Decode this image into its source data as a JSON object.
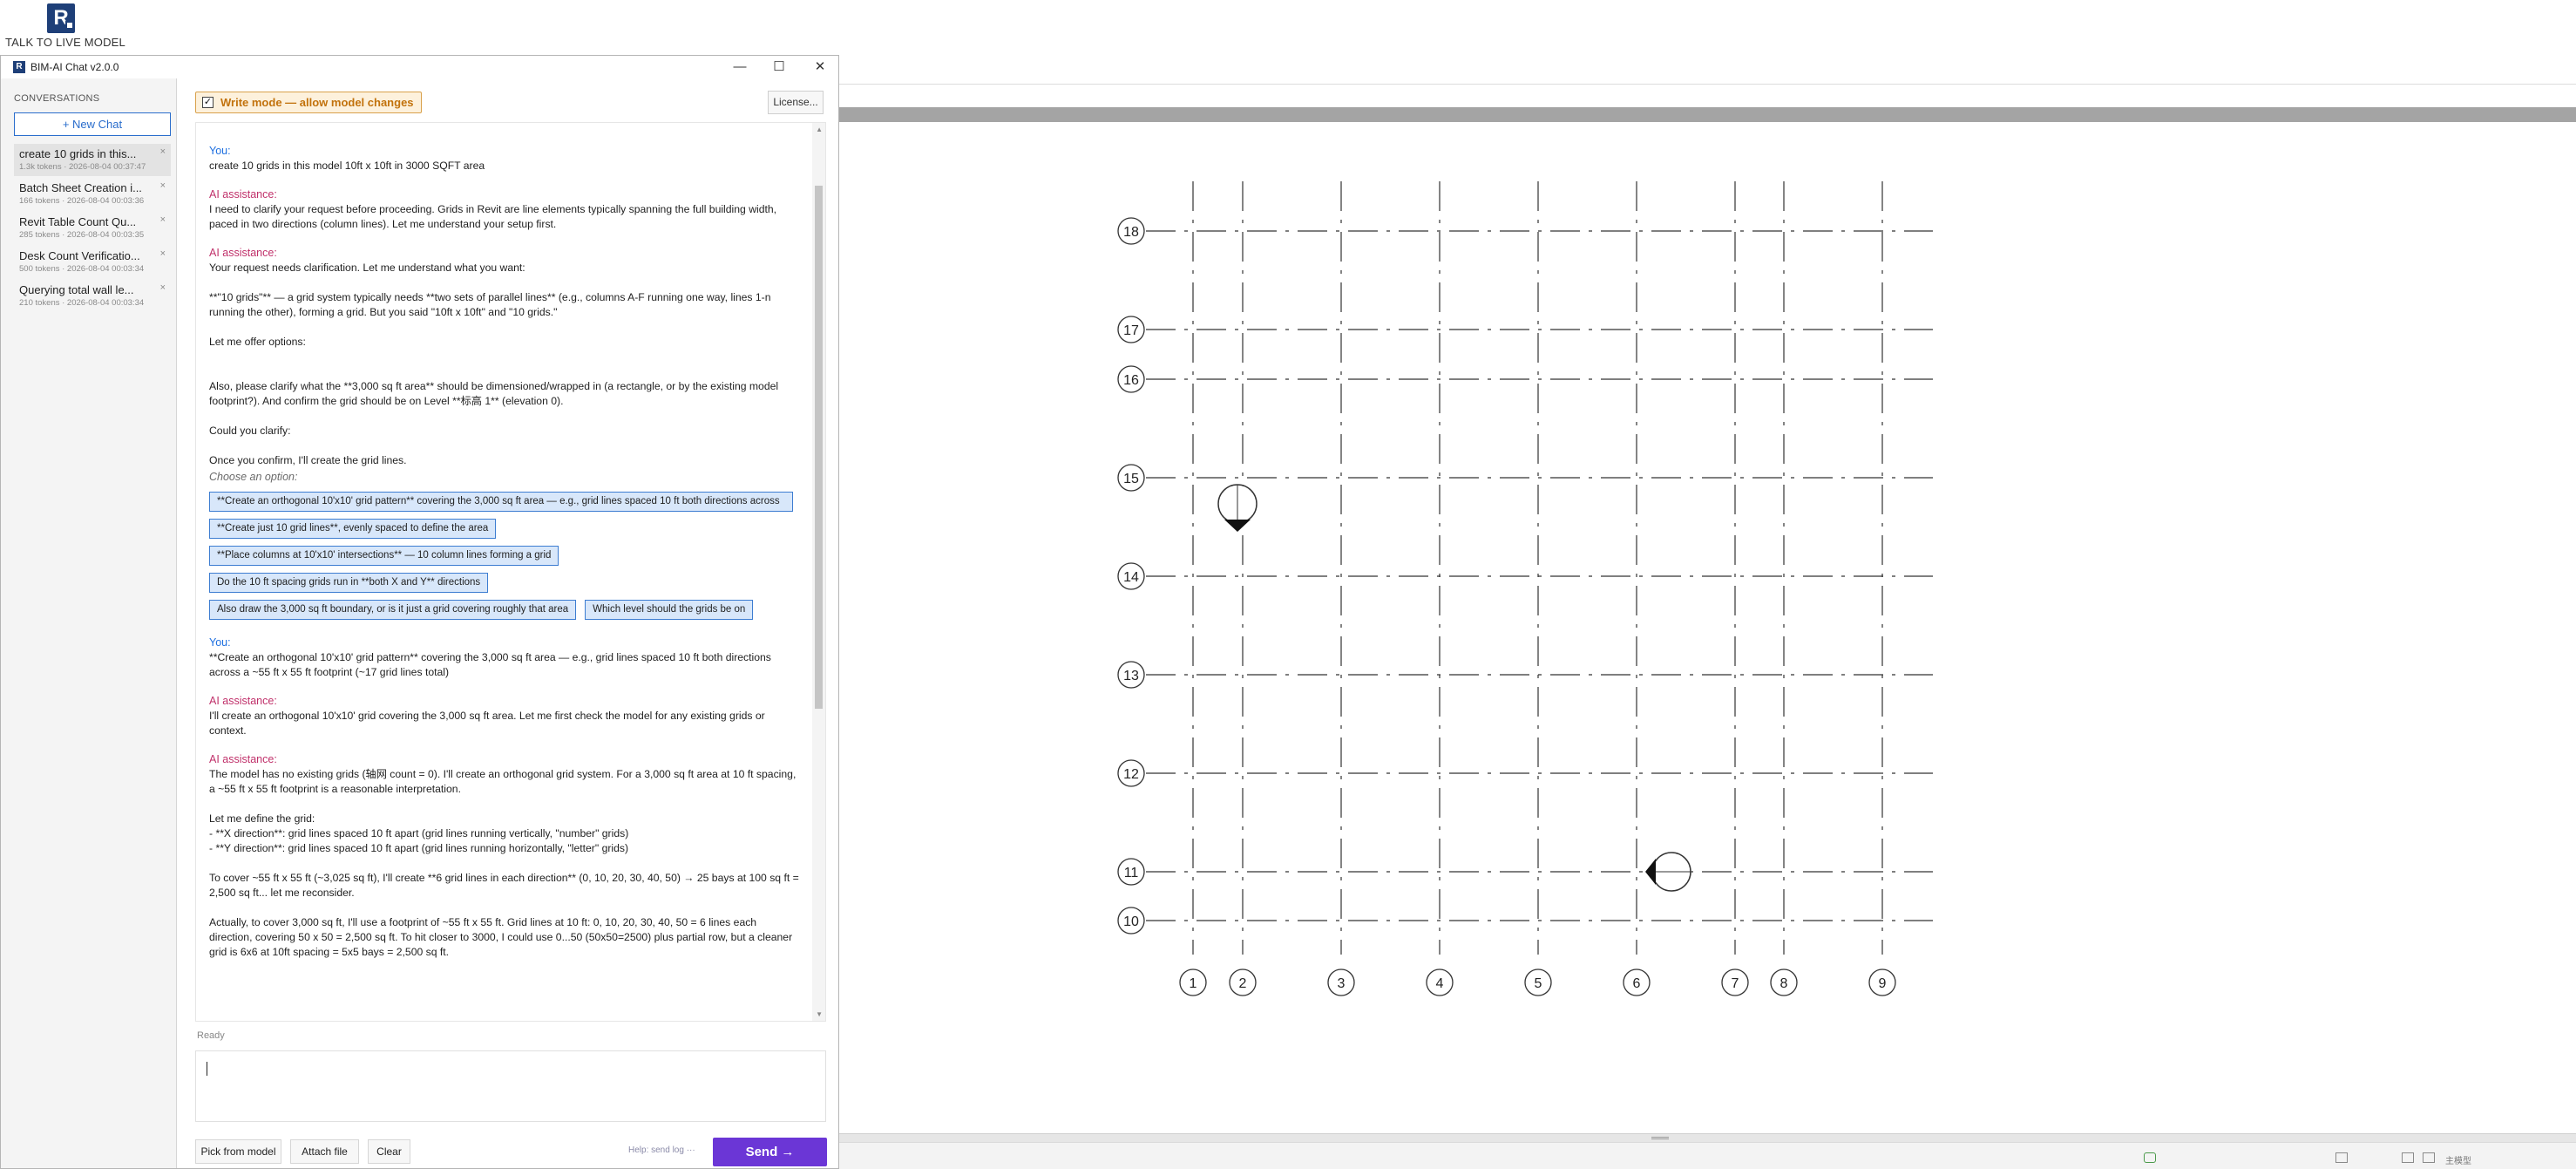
{
  "app": {
    "logo_letter": "R",
    "caption": "TALK TO LIVE MODEL",
    "status_text": "主模型"
  },
  "window": {
    "title": "BIM-AI Chat v2.0.0",
    "minimize": "—",
    "maximize": "☐",
    "close": "✕"
  },
  "sidebar": {
    "header": "CONVERSATIONS",
    "new_chat": "+ New Chat",
    "conversations": [
      {
        "title": "create 10 grids in this...",
        "meta": "1.3k tokens · 2026-08-04 00:37:47"
      },
      {
        "title": "Batch Sheet Creation i...",
        "meta": "166 tokens · 2026-08-04 00:03:36"
      },
      {
        "title": "Revit Table Count Qu...",
        "meta": "285 tokens · 2026-08-04 00:03:35"
      },
      {
        "title": "Desk Count Verificatio...",
        "meta": "500 tokens · 2026-08-04 00:03:34"
      },
      {
        "title": "Querying total wall le...",
        "meta": "210 tokens · 2026-08-04 00:03:34"
      }
    ],
    "close_glyph": "×"
  },
  "toolbar": {
    "write_mode": "Write mode — allow model changes",
    "write_mode_checked": "✓",
    "license": "License..."
  },
  "transcript": {
    "you_label": "You:",
    "ai_label": "AI assistance:",
    "m1": "create 10 grids in this model 10ft x 10ft in 3000 SQFT area",
    "m2": "I need to clarify your request before proceeding. Grids in Revit are line elements typically spanning the full building width, paced in two directions (column lines). Let me understand your setup first.",
    "m3_p1": "Your request needs clarification. Let me understand what you want:",
    "m3_p2": "**\"10 grids\"** — a grid system typically needs **two sets of parallel lines** (e.g., columns A-F running one way, lines 1-n running the other), forming a grid. But you said \"10ft x 10ft\" and \"10 grids.\"",
    "m3_p3": "Let me offer options:",
    "m3_p4": "Also, please clarify what the **3,000 sq ft area** should be dimensioned/wrapped in (a rectangle, or by the existing model footprint?). And confirm the grid should be on Level **标高 1** (elevation 0).",
    "m3_p5": "Could you clarify:",
    "m3_p6": "Once you confirm, I'll create the grid lines.",
    "choose": "Choose an option:",
    "options": [
      "**Create an orthogonal 10'x10' grid pattern** covering the 3,000 sq ft area — e.g., grid lines spaced 10 ft both directions across",
      "**Create just 10 grid lines**, evenly spaced to define the area",
      "**Place columns at 10'x10' intersections** — 10 column lines forming a grid",
      "Do the 10 ft spacing grids run in **both X and Y** directions",
      "Also draw the 3,000 sq ft boundary, or is it just a grid covering roughly that area",
      "Which level should the grids be on"
    ],
    "m4": "**Create an orthogonal 10'x10' grid pattern** covering the 3,000 sq ft area — e.g., grid lines spaced 10 ft both directions across a ~55 ft x 55 ft footprint (~17 grid lines total)",
    "m5": "I'll create an orthogonal 10'x10' grid covering the 3,000 sq ft area. Let me first check the model for any existing grids or context.",
    "m6_p1": "The model has no existing grids (轴网 count = 0). I'll create an orthogonal grid system. For a 3,000 sq ft area at 10 ft spacing, a ~55 ft x 55 ft footprint is a reasonable interpretation.",
    "m6_p2": "Let me define the grid:",
    "m6_p3": "- **X direction**: grid lines spaced 10 ft apart (grid lines running vertically, \"number\" grids)",
    "m6_p4": "- **Y direction**: grid lines spaced 10 ft apart (grid lines running horizontally, \"letter\" grids)",
    "m6_p5": "To cover ~55 ft x 55 ft (~3,025 sq ft), I'll create **6 grid lines in each direction** (0, 10, 20, 30, 40, 50) → 25 bays at 100 sq ft = 2,500 sq ft... let me reconsider.",
    "m6_p6": "Actually, to cover 3,000 sq ft, I'll use a footprint of ~55 ft x 55 ft. Grid lines at 10 ft: 0, 10, 20, 30, 40, 50 = 6 lines each direction, covering 50 x 50 = 2,500 sq ft. To hit closer to 3000, I could use 0...50 (50x50=2500) plus partial row, but a cleaner grid is 6x6 at 10ft spacing = 5x5 bays = 2,500 sq ft."
  },
  "status": {
    "ready": "Ready"
  },
  "composer": {
    "placeholder": ""
  },
  "buttons": {
    "pick": "Pick from model",
    "attach": "Attach file",
    "clear": "Clear",
    "help": "Help: send log ···",
    "send": "Send →"
  },
  "grids": {
    "horizontal": [
      {
        "label": "18"
      },
      {
        "label": "17"
      },
      {
        "label": "16"
      },
      {
        "label": "15"
      },
      {
        "label": "14"
      },
      {
        "label": "13"
      },
      {
        "label": "12"
      },
      {
        "label": "11"
      },
      {
        "label": "10"
      }
    ],
    "vertical": [
      {
        "label": "1"
      },
      {
        "label": "2"
      },
      {
        "label": "3"
      },
      {
        "label": "4"
      },
      {
        "label": "5"
      },
      {
        "label": "6"
      },
      {
        "label": "7"
      },
      {
        "label": "8"
      },
      {
        "label": "9"
      }
    ]
  },
  "colors": {
    "accent_blue": "#2a6dcc",
    "ai_label": "#c0306a",
    "you_label": "#1d6fe0",
    "write_mode": "#c2720c",
    "send": "#6b36d6"
  }
}
